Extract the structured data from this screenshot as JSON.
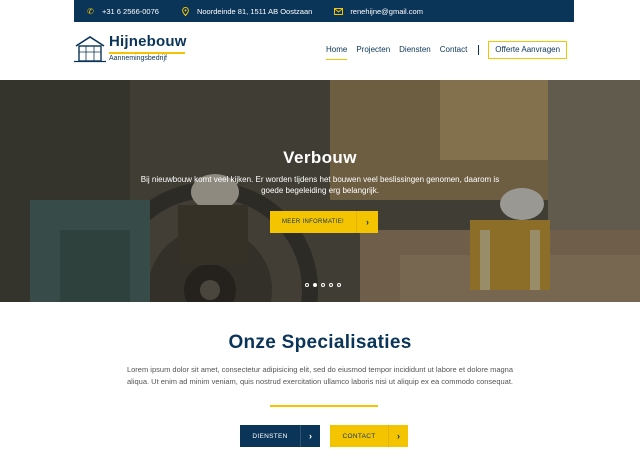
{
  "topbar": {
    "phone": "+31 6 2566-0076",
    "address": "Noordeinde 81, 1511 AB Oostzaan",
    "email": "renehijne@gmail.com"
  },
  "logo": {
    "name": "Hijnebouw",
    "subtitle": "Aannemingsbedrijf"
  },
  "nav": {
    "items": [
      "Home",
      "Projecten",
      "Diensten",
      "Contact"
    ],
    "active": "Home",
    "cta": "Offerte Aanvragen"
  },
  "hero": {
    "title": "Verbouw",
    "text": "Bij nieuwbouw komt veel kijken. Er worden tijdens het bouwen veel beslissingen genomen, daarom is goede begeleiding erg belangrijk.",
    "button": "MEER INFORMATIE!",
    "slides": 5,
    "active_slide": 2
  },
  "specialisaties": {
    "title": "Onze Specialisaties",
    "text": "Lorem ipsum dolor sit amet, consectetur adipisicing elit, sed do eiusmod tempor incididunt ut labore et dolore magna aliqua. Ut enim ad minim veniam, quis nostrud exercitation ullamco laboris nisi ut aliquip ex ea commodo consequat.",
    "buttons": [
      "DIENSTEN",
      "CONTACT"
    ]
  },
  "icons": {
    "phone": "phone-icon",
    "address": "map-pin-icon",
    "email": "envelope-icon",
    "arrow": "chevron-right-icon"
  },
  "colors": {
    "navy": "#0b3558",
    "yellow": "#f5c400"
  }
}
